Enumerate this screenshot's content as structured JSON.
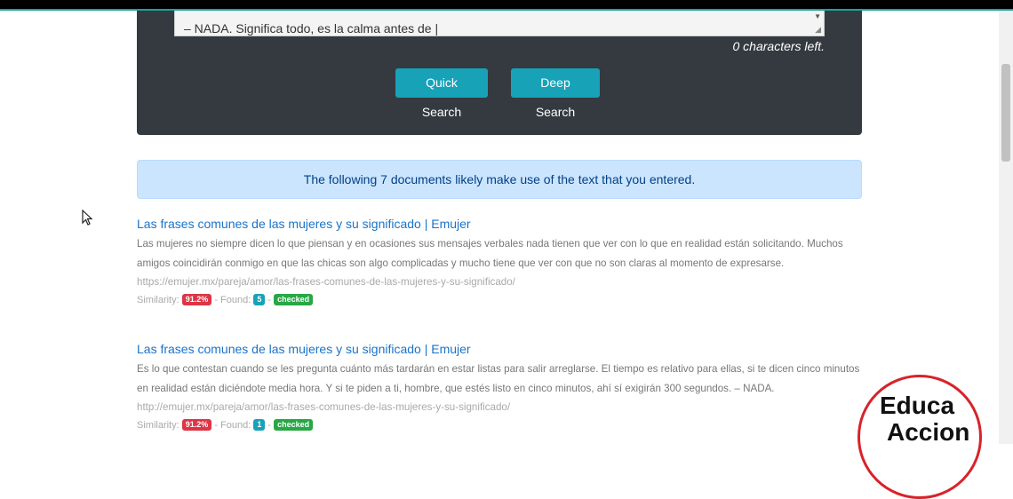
{
  "search_form": {
    "textarea_text": "– NADA. Significa todo, es la calma antes de |",
    "chars_left": "0 characters left.",
    "quick_search_label": "Quick Search",
    "deep_search_label": "Deep Search"
  },
  "alert": {
    "text": "The following 7 documents likely make use of the text that you entered."
  },
  "results": [
    {
      "title": "Las frases comunes de las mujeres y su significado | Emujer",
      "snippet": "Las mujeres no siempre dicen lo que piensan y en ocasiones sus mensajes verbales nada tienen que ver con lo que en realidad están solicitando. Muchos amigos coincidirán conmigo en que las chicas son algo complicadas y mucho tiene que ver con que no son claras al momento de expresarse.",
      "url": "https://emujer.mx/pareja/amor/las-frases-comunes-de-las-mujeres-y-su-significado/",
      "similarity_label": "Similarity:",
      "similarity": "91.2%",
      "sep1": " - ",
      "found_label": "Found:",
      "found": "5",
      "sep2": " - ",
      "status": "checked"
    },
    {
      "title": "Las frases comunes de las mujeres y su significado | Emujer",
      "snippet": "Es lo que contestan cuando se les pregunta cuánto más tardarán en estar listas para salir arreglarse. El tiempo es relativo para ellas, si te dicen cinco minutos en realidad están diciéndote media hora. Y si te piden a ti, hombre, que estés listo en cinco minutos, ahí sí exigirán 300 segundos. – NADA.",
      "url": "http://emujer.mx/pareja/amor/las-frases-comunes-de-las-mujeres-y-su-significado/",
      "similarity_label": "Similarity:",
      "similarity": "91.2%",
      "sep1": " - ",
      "found_label": "Found:",
      "found": "1",
      "sep2": " - ",
      "status": "checked"
    }
  ],
  "logo": {
    "line1": "Educa",
    "line2": "Accion"
  },
  "colors": {
    "panel": "#343a40",
    "button": "#17a2b8",
    "alert_bg": "#cce5ff",
    "link": "#1a73c9",
    "badge_red": "#dc3545",
    "badge_green": "#28a745"
  }
}
